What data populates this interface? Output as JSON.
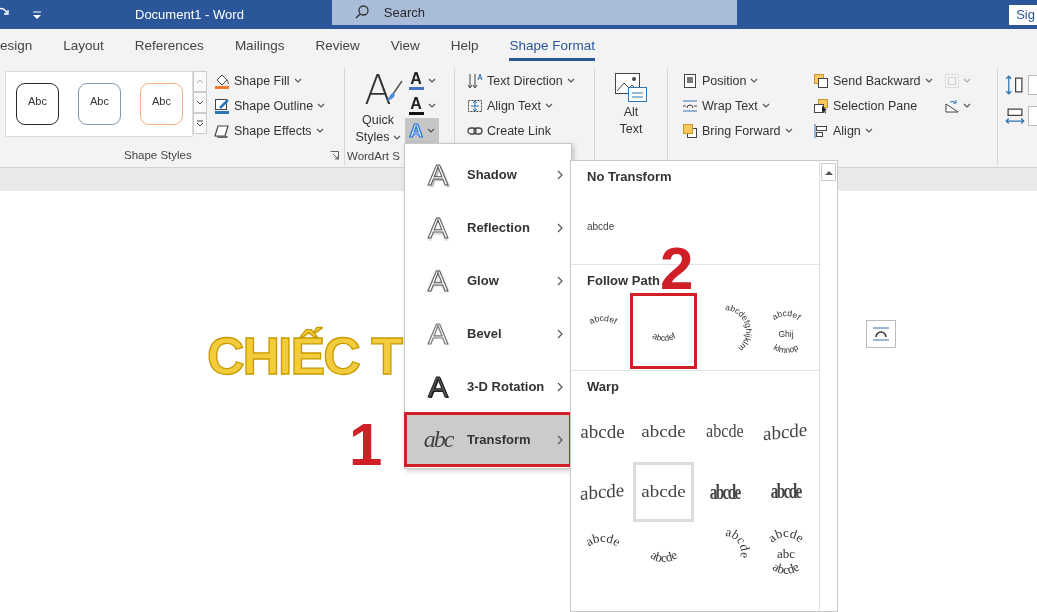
{
  "title_bar": {
    "title": "Document1 - Word",
    "search": {
      "placeholder": "Search"
    },
    "sign_in": "Sig"
  },
  "tabs": [
    {
      "label": "esign",
      "selected": false
    },
    {
      "label": "Layout",
      "selected": false
    },
    {
      "label": "References",
      "selected": false
    },
    {
      "label": "Mailings",
      "selected": false
    },
    {
      "label": "Review",
      "selected": false
    },
    {
      "label": "View",
      "selected": false
    },
    {
      "label": "Help",
      "selected": false
    },
    {
      "label": "Shape Format",
      "selected": true
    }
  ],
  "ribbon": {
    "shape_styles": {
      "presets": [
        {
          "label": "Abc",
          "color": "#262626"
        },
        {
          "label": "Abc",
          "color": "#8497b0"
        },
        {
          "label": "Abc",
          "color": "#f4b183"
        }
      ],
      "commands": [
        {
          "kind": "shape-fill",
          "label": "Shape Fill",
          "dropdown": true
        },
        {
          "kind": "shape-outline",
          "label": "Shape Outline",
          "dropdown": true
        },
        {
          "kind": "shape-effects",
          "label": "Shape Effects",
          "dropdown": true
        }
      ],
      "group_label": "Shape Styles"
    },
    "wordart_styles": {
      "quick_styles": {
        "glyph": "A",
        "lines": [
          "Quick",
          "Styles"
        ]
      },
      "buttons": [
        {
          "kind": "text-fill",
          "glyph": "A",
          "pressed": false
        },
        {
          "kind": "text-outline",
          "glyph": "A",
          "pressed": false
        },
        {
          "kind": "text-effects",
          "glyph": "A",
          "pressed": true
        }
      ],
      "group_label": "WordArt S"
    },
    "text": {
      "commands": [
        {
          "kind": "text-direction",
          "label": "Text Direction",
          "dropdown": true
        },
        {
          "kind": "align-text",
          "label": "Align Text",
          "dropdown": true
        },
        {
          "kind": "create-link",
          "label": "Create Link",
          "dropdown": false
        }
      ]
    },
    "accessibility": {
      "lines": [
        "Alt",
        "Text"
      ]
    },
    "arrange": {
      "commands": [
        {
          "kind": "position",
          "label": "Position",
          "dropdown": true
        },
        {
          "kind": "wrap-text",
          "label": "Wrap Text",
          "dropdown": true
        },
        {
          "kind": "bring-forward",
          "label": "Bring Forward",
          "dropdown": true
        },
        {
          "kind": "send-backward",
          "label": "Send Backward",
          "dropdown": true
        },
        {
          "kind": "selection-pane",
          "label": "Selection Pane",
          "dropdown": false
        },
        {
          "kind": "align",
          "label": "Align",
          "dropdown": true
        }
      ],
      "icon_buttons": [
        {
          "kind": "group",
          "disabled": true
        },
        {
          "kind": "rotate",
          "disabled": false
        }
      ]
    },
    "size": {
      "fields": [
        {
          "kind": "height"
        },
        {
          "kind": "width"
        }
      ]
    }
  },
  "document": {
    "wordart_text": "CHIẾC T"
  },
  "effects_menu": {
    "items": [
      {
        "kind": "shadow",
        "glyph": "A",
        "label": "Shadow",
        "selected": false
      },
      {
        "kind": "reflection",
        "glyph": "A",
        "label": "Reflection",
        "selected": false
      },
      {
        "kind": "glow",
        "glyph": "A",
        "label": "Glow",
        "selected": false
      },
      {
        "kind": "bevel",
        "glyph": "A",
        "label": "Bevel",
        "selected": false
      },
      {
        "kind": "rotation-3d",
        "glyph": "A",
        "label": "3-D Rotation",
        "selected": false
      },
      {
        "kind": "transform",
        "glyph": "abc",
        "label": "Transform",
        "selected": true,
        "annotation": "1"
      }
    ]
  },
  "transform_gallery": {
    "sections": [
      {
        "title": "No Transform",
        "items": [
          {
            "kind": "none",
            "lines": [
              "abcde"
            ],
            "highlighted": false
          }
        ]
      },
      {
        "title": "Follow Path",
        "items": [
          {
            "kind": "follow-arch",
            "lines": [
              "abcdef"
            ],
            "highlighted": false
          },
          {
            "kind": "follow-arch-down",
            "lines": [
              "abcdef"
            ],
            "highlighted": false,
            "annotation": "2"
          },
          {
            "kind": "follow-circle",
            "lines": [
              "abcdefghijklm"
            ],
            "highlighted": false
          },
          {
            "kind": "follow-button",
            "lines": [
              "abcdef",
              "Ghij",
              "klmnop"
            ],
            "highlighted": false
          }
        ]
      },
      {
        "title": "Warp",
        "items": [
          {
            "kind": "square",
            "lines": [
              "abcde"
            ],
            "highlighted": false
          },
          {
            "kind": "stop",
            "lines": [
              "abcde"
            ],
            "highlighted": false
          },
          {
            "kind": "triangle-up",
            "lines": [
              "abcde"
            ],
            "highlighted": false
          },
          {
            "kind": "triangle-down",
            "lines": [
              "abcde"
            ],
            "highlighted": false
          },
          {
            "kind": "chevron-up",
            "lines": [
              "abcde"
            ],
            "highlighted": false
          },
          {
            "kind": "chevron-down",
            "lines": [
              "abcde"
            ],
            "highlighted": true
          },
          {
            "kind": "ring-inside",
            "lines": [
              "abcde"
            ],
            "highlighted": false
          },
          {
            "kind": "ring-outside",
            "lines": [
              "abcde"
            ],
            "highlighted": false
          },
          {
            "kind": "arch-up",
            "lines": [
              "abcde"
            ],
            "highlighted": false
          },
          {
            "kind": "arch-down",
            "lines": [
              "abcde"
            ],
            "highlighted": false
          },
          {
            "kind": "circle",
            "lines": [
              "abcde"
            ],
            "highlighted": false
          },
          {
            "kind": "button",
            "lines": [
              "abcde",
              "abc",
              "abcde"
            ],
            "highlighted": false
          }
        ]
      }
    ]
  }
}
